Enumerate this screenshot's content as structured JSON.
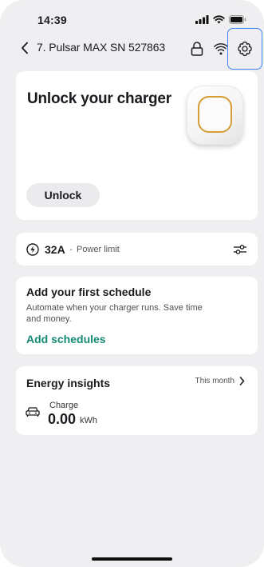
{
  "status_bar": {
    "time": "14:39"
  },
  "header": {
    "title": "7. Pulsar MAX SN 527863",
    "icons": [
      "chevron-left-icon",
      "lock-icon",
      "wifi-icon",
      "gear-icon"
    ]
  },
  "unlock_card": {
    "title": "Unlock your charger",
    "button_label": "Unlock",
    "accent_color": "#d59d35"
  },
  "power_limit": {
    "value": "32A",
    "separator": "·",
    "label": "Power limit"
  },
  "schedule": {
    "title": "Add your first schedule",
    "description": "Automate when your charger runs. Save time and money.",
    "link_label": "Add schedules",
    "link_color": "#168a72"
  },
  "energy": {
    "title": "Energy insights",
    "period": "This month",
    "charge_label": "Charge",
    "charge_value": "0.00",
    "charge_unit": "kWh"
  },
  "colors": {
    "background": "#efeff1",
    "card": "#ffffff",
    "highlight": "#3b82f6"
  }
}
